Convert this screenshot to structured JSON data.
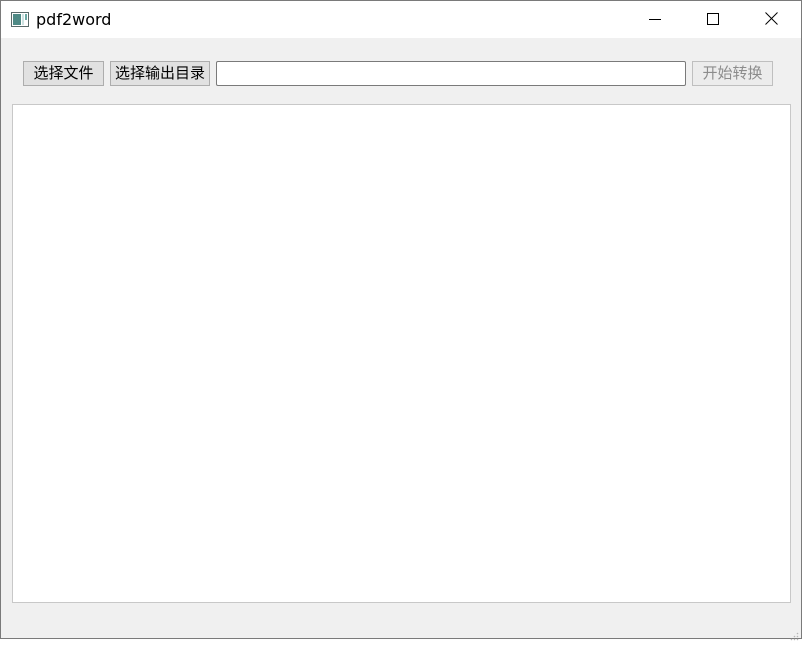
{
  "window": {
    "title": "pdf2word",
    "app_icon": "app-window-icon",
    "controls": {
      "minimize_icon": "minimize-icon",
      "maximize_icon": "maximize-icon",
      "close_icon": "close-icon"
    }
  },
  "toolbar": {
    "select_file_label": "选择文件",
    "select_output_dir_label": "选择输出目录",
    "path_input_value": "",
    "path_input_placeholder": "",
    "start_convert_label": "开始转换",
    "start_convert_enabled": false
  },
  "log": {
    "content": ""
  },
  "colors": {
    "window_background": "#f0f0f0",
    "titlebar_background": "#ffffff",
    "button_face": "#e1e1e1",
    "disabled_text": "#8c8c8c"
  }
}
